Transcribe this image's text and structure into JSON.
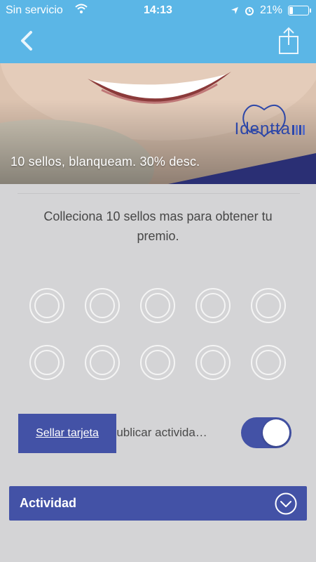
{
  "status": {
    "carrier": "Sin servicio",
    "time": "14:13",
    "battery": "21%",
    "battery_level": 0.21
  },
  "nav": {
    "back_icon": "chevron-left-icon",
    "share_icon": "share-icon"
  },
  "hero": {
    "title": "10 sellos, blanqueam. 30% desc.",
    "logo_text": "Identta"
  },
  "card": {
    "message": "Colleciona 10 sellos mas para obtener tu premio.",
    "stamps_total": 10,
    "stamps_collected": 0
  },
  "actions": {
    "stamp_button": "Sellar tarjeta",
    "publish_label": "Publicar activida…",
    "publish_enabled": true
  },
  "activity": {
    "title": "Actividad",
    "expand_icon": "chevron-down-circle-icon"
  },
  "colors": {
    "header": "#5bb6e6",
    "accent": "#4352a6",
    "background": "#d4d4d6"
  }
}
